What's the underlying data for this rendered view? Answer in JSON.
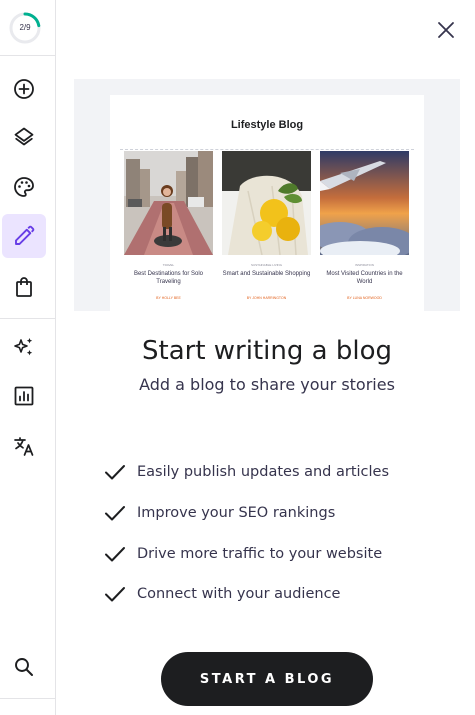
{
  "sidebar": {
    "progress_text": "2/9",
    "progress_fraction": 0.2222,
    "items": [
      {
        "name": "add-element-button",
        "icon": "plus-circle-icon"
      },
      {
        "name": "layers-button",
        "icon": "layers-icon"
      },
      {
        "name": "website-styles-button",
        "icon": "palette-icon"
      },
      {
        "name": "blog-button",
        "icon": "pencil-icon",
        "active": true
      },
      {
        "name": "store-button",
        "icon": "shopping-bag-icon"
      },
      {
        "name": "ai-tools-button",
        "icon": "sparkles-icon"
      },
      {
        "name": "analytics-button",
        "icon": "chart-icon"
      },
      {
        "name": "translate-button",
        "icon": "translate-icon"
      },
      {
        "name": "search-button",
        "icon": "search-icon"
      }
    ]
  },
  "panel": {
    "close_icon": "close-icon",
    "preview": {
      "blog_title": "Lifestyle Blog",
      "posts": [
        {
          "category": "TRAVEL",
          "title": "Best Destinations for Solo Traveling",
          "author": "BY HOLLY BEE"
        },
        {
          "category": "SUSTAINABLE LIVING",
          "title": "Smart and Sustainable Shopping",
          "author": "BY JOHN HARRINGTON"
        },
        {
          "category": "INSPIRATION",
          "title": "Most Visited Countries in the World",
          "author": "BY LUNA NORWOOD"
        }
      ]
    },
    "heading": "Start writing a blog",
    "subheading": "Add a blog to share your stories",
    "features": [
      "Easily publish updates and articles",
      "Improve your SEO rankings",
      "Drive more traffic to your website",
      "Connect with your audience"
    ],
    "cta_label": "START A BLOG"
  },
  "colors": {
    "accent": "#673de6",
    "active_bg": "#ebe4ff",
    "progress": "#00b090",
    "dark": "#1d1e20"
  }
}
